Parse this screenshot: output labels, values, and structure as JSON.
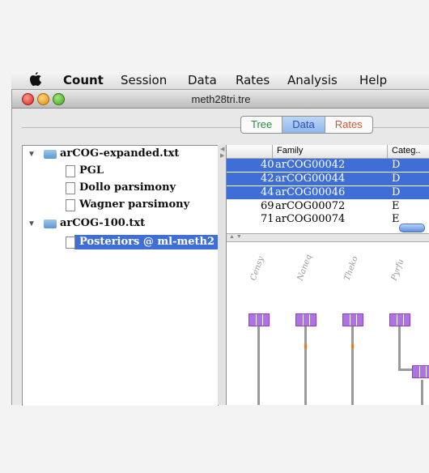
{
  "menubar": {
    "app": "Count",
    "items": [
      "Session",
      "Data",
      "Rates",
      "Analysis",
      "Help"
    ]
  },
  "window": {
    "title": "meth28tri.tre"
  },
  "tabs": [
    "Tree",
    "Data",
    "Rates"
  ],
  "tree": [
    {
      "label": "arCOG-expanded.txt",
      "type": "folder",
      "expanded": true
    },
    {
      "label": "PGL",
      "type": "doc"
    },
    {
      "label": "Dollo parsimony",
      "type": "doc"
    },
    {
      "label": "Wagner parsimony",
      "type": "doc"
    },
    {
      "label": "arCOG-100.txt",
      "type": "folder",
      "expanded": true
    },
    {
      "label": "Posteriors @ ml-meth2",
      "type": "doc",
      "selected": true
    }
  ],
  "table": {
    "headers": [
      "Family",
      "Categ.."
    ],
    "rows": [
      {
        "num": "40",
        "family": "arCOG00042",
        "cat": "D",
        "selected": true
      },
      {
        "num": "42",
        "family": "arCOG00044",
        "cat": "D",
        "selected": true
      },
      {
        "num": "44",
        "family": "arCOG00046",
        "cat": "D",
        "selected": true
      },
      {
        "num": "69",
        "family": "arCOG00072",
        "cat": "E",
        "selected": false
      },
      {
        "num": "71",
        "family": "arCOG00074",
        "cat": "E",
        "selected": false
      }
    ]
  },
  "taxa": [
    "Censy",
    "Naneq",
    "Theko",
    "Pyrfu"
  ],
  "colors": {
    "accent": "#3f6fd6",
    "node": "#b070e6",
    "marker": "#f07a1a"
  }
}
